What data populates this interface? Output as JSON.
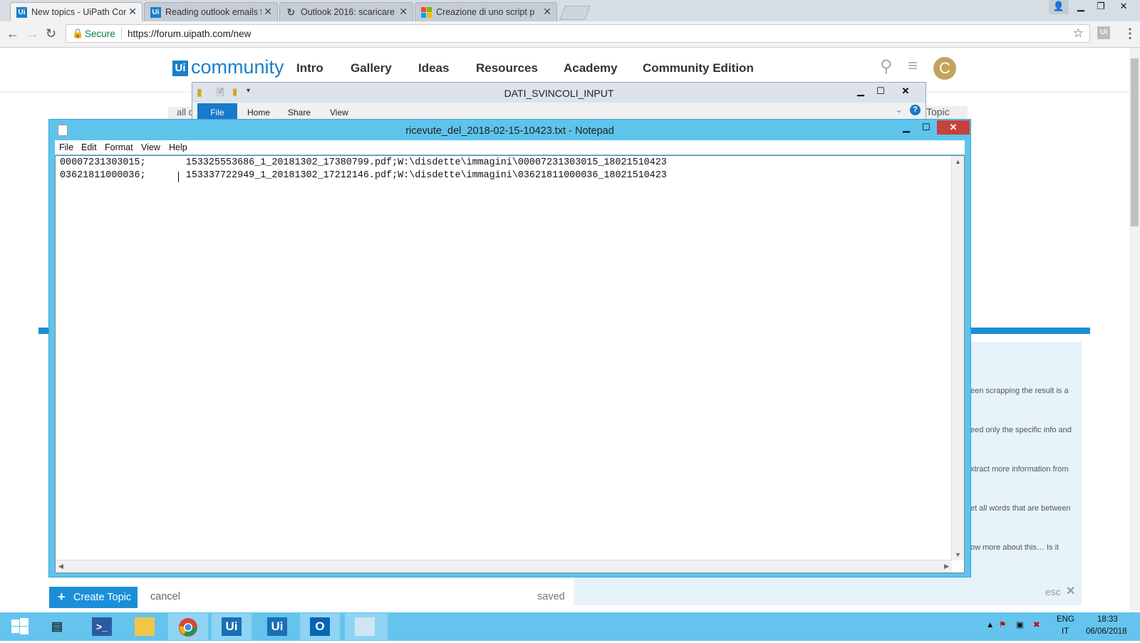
{
  "browser": {
    "tabs": [
      {
        "title": "New topics - UiPath Com",
        "icon": "uipath-icon",
        "active": true
      },
      {
        "title": "Reading outlook emails f",
        "icon": "uipath-icon",
        "active": false
      },
      {
        "title": "Outlook 2016: scaricare i",
        "icon": "loading-icon",
        "active": false
      },
      {
        "title": "Creazione di uno script p",
        "icon": "microsoft-icon",
        "active": false
      }
    ],
    "secure_label": "Secure",
    "url": "https://forum.uipath.com/new",
    "window_controls": [
      "minimize",
      "restore",
      "close"
    ]
  },
  "forum": {
    "logo_badge": "Ui",
    "logo_text": "community",
    "nav": [
      "Intro",
      "Gallery",
      "Ideas",
      "Resources",
      "Academy",
      "Community Edition"
    ],
    "avatar_letter": "C",
    "bg_fragment_left": "all c",
    "bg_fragment_right": "Topic"
  },
  "composer": {
    "create_label": "Create Topic",
    "cancel_label": "cancel",
    "saved_label": "saved",
    "esc_label": "esc",
    "preview_lines": [
      "een scrapping the result is a",
      "eed only the specific info and",
      "xtract more information from",
      "et all words that are between",
      "ow more about this… Is it"
    ]
  },
  "explorer": {
    "title": "DATI_SVINCOLI_INPUT",
    "tabs": [
      "File",
      "Home",
      "Share",
      "View"
    ]
  },
  "notepad": {
    "title": "ricevute_del_2018-02-15-10423.txt - Notepad",
    "menu": [
      "File",
      "Edit",
      "Format",
      "View",
      "Help"
    ],
    "lines": [
      "00007231303015;       153325553686_1_20181302_17380799.pdf;W:\\disdette\\immagini\\00007231303015_18021510423",
      "03621811000036;       153337722949_1_20181302_17212146.pdf;W:\\disdette\\immagini\\03621811000036_18021510423"
    ]
  },
  "taskbar": {
    "apps": [
      "windows-start-icon",
      "server-manager-icon",
      "powershell-icon",
      "file-explorer-icon",
      "chrome-icon",
      "uipath-studio-icon",
      "uipath-robot-icon",
      "outlook-icon",
      "notepad-icon"
    ],
    "lang_top": "ENG",
    "lang_bottom": "IT",
    "time": "18:33",
    "date": "06/06/2018"
  },
  "colors": {
    "uipath_blue": "#1a7fc9",
    "notepad_frame": "#5ec4ec",
    "taskbar": "#64c4ee",
    "close_red": "#c8413b"
  }
}
